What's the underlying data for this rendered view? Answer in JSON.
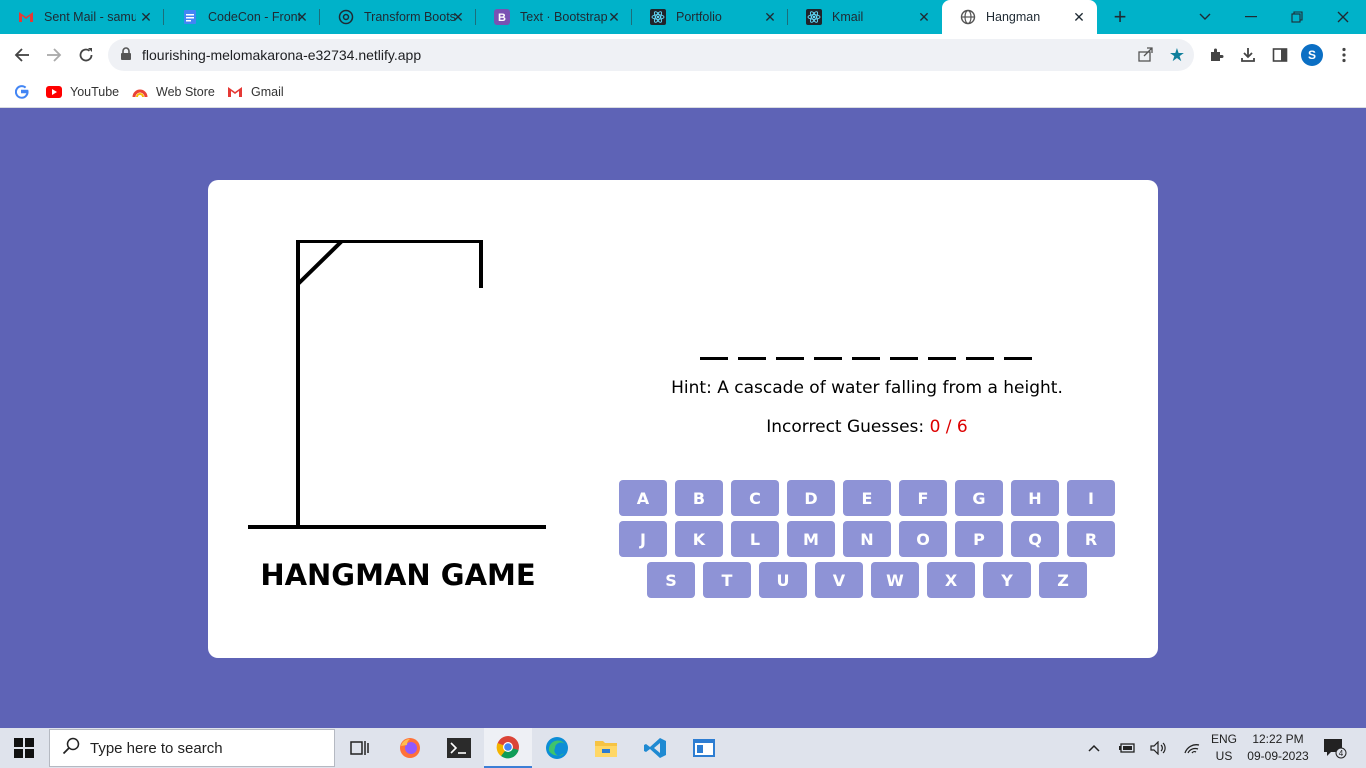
{
  "browser": {
    "tabs": [
      {
        "title": "Sent Mail - samu",
        "icon": "gmail-icon"
      },
      {
        "title": "CodeCon - Front",
        "icon": "docs-icon"
      },
      {
        "title": "Transform Boots",
        "icon": "chatgpt-icon"
      },
      {
        "title": "Text · Bootstrap v",
        "icon": "bootstrap-icon"
      },
      {
        "title": "Portfolio",
        "icon": "react-icon"
      },
      {
        "title": "Kmail",
        "icon": "react-icon"
      },
      {
        "title": "Hangman",
        "icon": "globe-icon",
        "active": true
      }
    ],
    "url": "flourishing-melomakarona-e32734.netlify.app",
    "profile_initial": "S",
    "bookmarks": [
      {
        "label": "",
        "icon": "google-icon"
      },
      {
        "label": "YouTube",
        "icon": "youtube-icon"
      },
      {
        "label": "Web Store",
        "icon": "webstore-icon"
      },
      {
        "label": "Gmail",
        "icon": "gmail-icon"
      }
    ]
  },
  "game": {
    "title": "HANGMAN GAME",
    "word_slots": [
      "",
      "",
      "",
      "",
      "",
      "",
      "",
      "",
      ""
    ],
    "hint_label": "Hint:",
    "hint_text": "A cascade of water falling from a height.",
    "incorrect_label": "Incorrect Guesses:",
    "incorrect_count": "0 / 6",
    "incorrect_color": "#dd0000",
    "keys": [
      "A",
      "B",
      "C",
      "D",
      "E",
      "F",
      "G",
      "H",
      "I",
      "J",
      "K",
      "L",
      "M",
      "N",
      "O",
      "P",
      "Q",
      "R",
      "S",
      "T",
      "U",
      "V",
      "W",
      "X",
      "Y",
      "Z"
    ],
    "key_color": "#8e93d6",
    "background_color": "#5e63b6"
  },
  "taskbar": {
    "search_placeholder": "Type here to search",
    "lang_line1": "ENG",
    "lang_line2": "US",
    "time": "12:22 PM",
    "date": "09-09-2023",
    "notification_count": "4"
  }
}
